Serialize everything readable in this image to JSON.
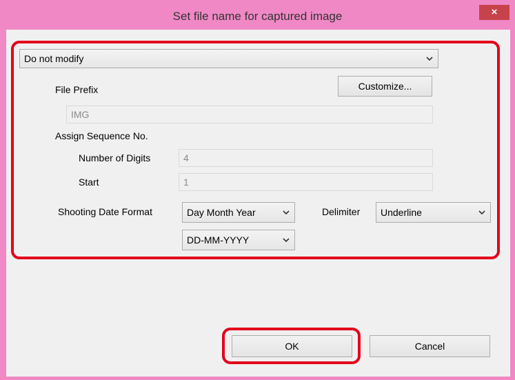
{
  "window": {
    "title": "Set file name for captured image",
    "close_glyph": "×"
  },
  "preset": {
    "value": "Do not modify"
  },
  "file_prefix": {
    "label": "File Prefix",
    "customize_label": "Customize...",
    "value": "IMG"
  },
  "sequence": {
    "label": "Assign Sequence No.",
    "digits_label": "Number of Digits",
    "digits_value": "4",
    "start_label": "Start",
    "start_value": "1"
  },
  "date": {
    "label": "Shooting Date Format",
    "order_value": "Day Month Year",
    "pattern_value": "DD-MM-YYYY",
    "delimiter_label": "Delimiter",
    "delimiter_value": "Underline"
  },
  "buttons": {
    "ok": "OK",
    "cancel": "Cancel"
  },
  "colors": {
    "frame": "#f088c6",
    "close": "#c7434b",
    "highlight": "#e3001b"
  },
  "icons": {
    "dropdown": "chevron-down-icon",
    "close": "close-icon"
  }
}
